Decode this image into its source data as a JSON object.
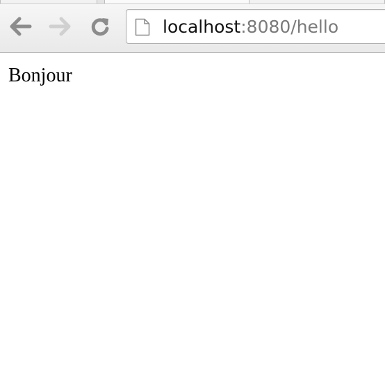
{
  "toolbar": {
    "back_icon": "arrow-left-icon",
    "forward_icon": "arrow-right-icon",
    "reload_icon": "reload-icon",
    "forward_enabled": false
  },
  "omnibox": {
    "page_icon": "document-icon",
    "url_host": "localhost",
    "url_rest": ":8080/hello"
  },
  "page": {
    "text": "Bonjour"
  },
  "colors": {
    "toolbar_bg": "#ececec",
    "icon_active": "#8c8c8c",
    "icon_disabled": "#d0d0d0",
    "url_host": "#111111",
    "url_rest": "#7a7a7a"
  }
}
